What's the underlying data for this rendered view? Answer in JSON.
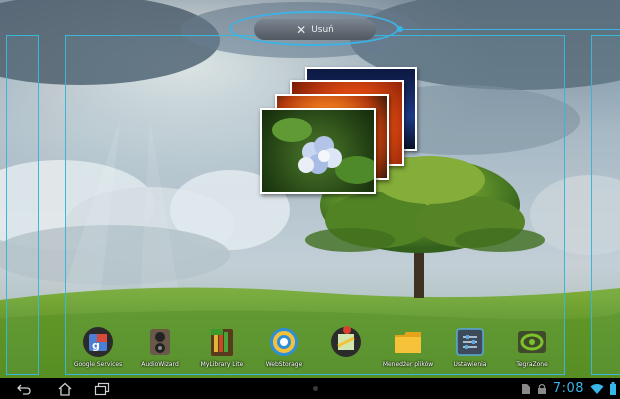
{
  "top_bar": {
    "remove_label": "Usuń",
    "remove_icon": "close-icon"
  },
  "accent_color": "#37b6e8",
  "dock": {
    "apps": [
      {
        "label": "Google Services",
        "icon": "google-services-icon"
      },
      {
        "label": "AudioWizard",
        "icon": "audiowizard-icon"
      },
      {
        "label": "MyLibrary Lite",
        "icon": "mylibrary-icon"
      },
      {
        "label": "WebStorage",
        "icon": "webstorage-icon"
      },
      {
        "label": "",
        "icon": "maps-icon"
      },
      {
        "label": "Menedżer plików",
        "icon": "file-manager-icon"
      },
      {
        "label": "Ustawienia",
        "icon": "settings-icon"
      },
      {
        "label": "TegraZone",
        "icon": "tegrazone-icon"
      }
    ]
  },
  "navigation": {
    "back": "back-icon",
    "home": "home-icon",
    "recent": "recent-apps-icon"
  },
  "status_bar": {
    "time": "7:08",
    "icons": [
      "document-icon",
      "lock-icon",
      "wifi-icon",
      "battery-icon"
    ]
  }
}
